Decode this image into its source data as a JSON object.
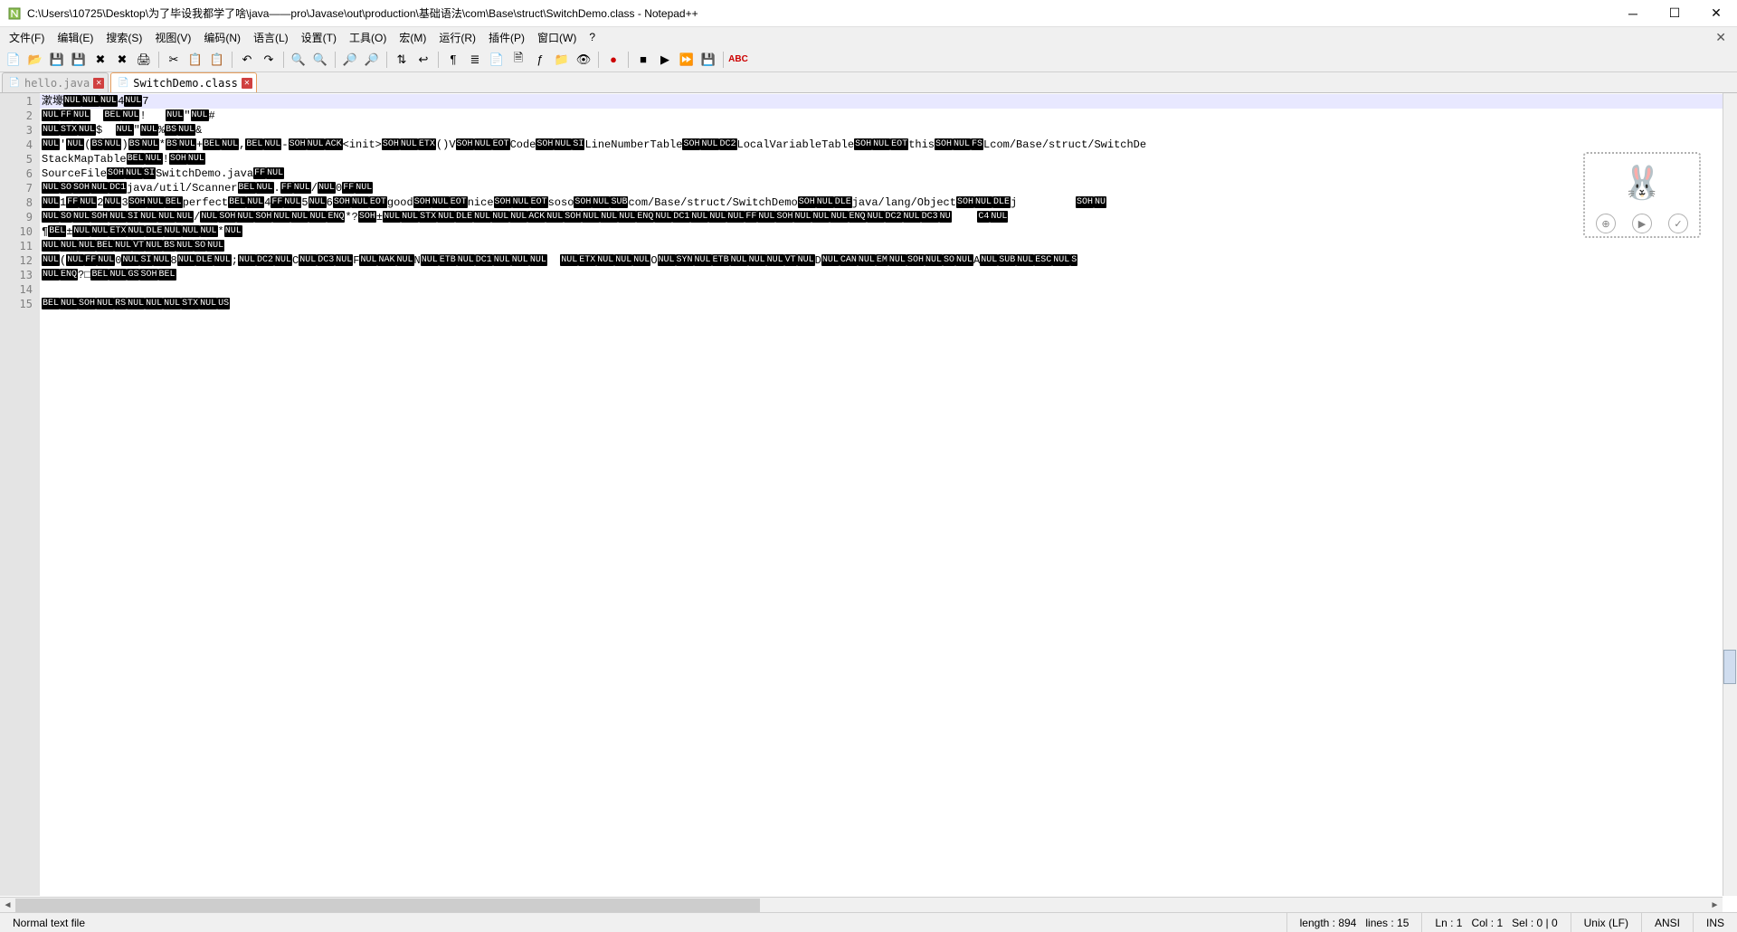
{
  "title": "C:\\Users\\10725\\Desktop\\为了毕设我都学了啥\\java——pro\\Javase\\out\\production\\基础语法\\com\\Base\\struct\\SwitchDemo.class - Notepad++",
  "menus": [
    "文件(F)",
    "编辑(E)",
    "搜索(S)",
    "视图(V)",
    "编码(N)",
    "语言(L)",
    "设置(T)",
    "工具(O)",
    "宏(M)",
    "运行(R)",
    "插件(P)",
    "窗口(W)",
    "?"
  ],
  "tabs": [
    {
      "label": "hello.java",
      "active": false
    },
    {
      "label": "SwitchDemo.class",
      "active": true
    }
  ],
  "status": {
    "filetype": "Normal text file",
    "length": "length : 894",
    "lines": "lines : 15",
    "ln": "Ln : 1",
    "col": "Col : 1",
    "sel": "Sel : 0 | 0",
    "eol": "Unix (LF)",
    "enc": "ANSI",
    "mode": "INS"
  },
  "lines": [
    [
      {
        "t": "txt",
        "v": "漱壕"
      },
      {
        "t": "ctl",
        "v": "NUL"
      },
      {
        "t": "ctl",
        "v": "NUL"
      },
      {
        "t": "ctl",
        "v": "NUL"
      },
      {
        "t": "txt",
        "v": "4"
      },
      {
        "t": "ctl",
        "v": "NUL"
      },
      {
        "t": "txt",
        "v": "7"
      }
    ],
    [
      {
        "t": "ctl",
        "v": "NUL"
      },
      {
        "t": "ctl",
        "v": "FF"
      },
      {
        "t": "ctl",
        "v": "NUL"
      },
      {
        "t": "txt",
        "v": "  "
      },
      {
        "t": "ctl",
        "v": "BEL"
      },
      {
        "t": "ctl",
        "v": "NUL"
      },
      {
        "t": "txt",
        "v": "!   "
      },
      {
        "t": "ctl",
        "v": "NUL"
      },
      {
        "t": "txt",
        "v": "\""
      },
      {
        "t": "ctl",
        "v": "NUL"
      },
      {
        "t": "txt",
        "v": "#"
      }
    ],
    [
      {
        "t": "ctl",
        "v": "NUL"
      },
      {
        "t": "ctl",
        "v": "STX"
      },
      {
        "t": "ctl",
        "v": "NUL"
      },
      {
        "t": "txt",
        "v": "$  "
      },
      {
        "t": "ctl",
        "v": "NUL"
      },
      {
        "t": "txt",
        "v": "\""
      },
      {
        "t": "ctl",
        "v": "NUL"
      },
      {
        "t": "txt",
        "v": "%"
      },
      {
        "t": "ctl",
        "v": "BS"
      },
      {
        "t": "ctl",
        "v": "NUL"
      },
      {
        "t": "txt",
        "v": "&"
      }
    ],
    [
      {
        "t": "ctl",
        "v": "NUL"
      },
      {
        "t": "txt",
        "v": "'"
      },
      {
        "t": "ctl",
        "v": "NUL"
      },
      {
        "t": "txt",
        "v": "("
      },
      {
        "t": "ctl",
        "v": "BS"
      },
      {
        "t": "ctl",
        "v": "NUL"
      },
      {
        "t": "txt",
        "v": ")"
      },
      {
        "t": "ctl",
        "v": "BS"
      },
      {
        "t": "ctl",
        "v": "NUL"
      },
      {
        "t": "txt",
        "v": "*"
      },
      {
        "t": "ctl",
        "v": "BS"
      },
      {
        "t": "ctl",
        "v": "NUL"
      },
      {
        "t": "txt",
        "v": "+"
      },
      {
        "t": "ctl",
        "v": "BEL"
      },
      {
        "t": "ctl",
        "v": "NUL"
      },
      {
        "t": "txt",
        "v": ","
      },
      {
        "t": "ctl",
        "v": "BEL"
      },
      {
        "t": "ctl",
        "v": "NUL"
      },
      {
        "t": "txt",
        "v": "-"
      },
      {
        "t": "ctl",
        "v": "SOH"
      },
      {
        "t": "ctl",
        "v": "NUL"
      },
      {
        "t": "ctl",
        "v": "ACK"
      },
      {
        "t": "txt",
        "v": "<init>"
      },
      {
        "t": "ctl",
        "v": "SOH"
      },
      {
        "t": "ctl",
        "v": "NUL"
      },
      {
        "t": "ctl",
        "v": "ETX"
      },
      {
        "t": "txt",
        "v": "()V"
      },
      {
        "t": "ctl",
        "v": "SOH"
      },
      {
        "t": "ctl",
        "v": "NUL"
      },
      {
        "t": "ctl",
        "v": "EOT"
      },
      {
        "t": "txt",
        "v": "Code"
      },
      {
        "t": "ctl",
        "v": "SOH"
      },
      {
        "t": "ctl",
        "v": "NUL"
      },
      {
        "t": "ctl",
        "v": "SI"
      },
      {
        "t": "txt",
        "v": "LineNumberTable"
      },
      {
        "t": "ctl",
        "v": "SOH"
      },
      {
        "t": "ctl",
        "v": "NUL"
      },
      {
        "t": "ctl",
        "v": "DC2"
      },
      {
        "t": "txt",
        "v": "LocalVariableTable"
      },
      {
        "t": "ctl",
        "v": "SOH"
      },
      {
        "t": "ctl",
        "v": "NUL"
      },
      {
        "t": "ctl",
        "v": "EOT"
      },
      {
        "t": "txt",
        "v": "this"
      },
      {
        "t": "ctl",
        "v": "SOH"
      },
      {
        "t": "ctl",
        "v": "NUL"
      },
      {
        "t": "ctl",
        "v": "FS"
      },
      {
        "t": "txt",
        "v": "Lcom/Base/struct/SwitchDe"
      }
    ],
    [
      {
        "t": "txt",
        "v": "StackMapTable"
      },
      {
        "t": "ctl",
        "v": "BEL"
      },
      {
        "t": "ctl",
        "v": "NUL"
      },
      {
        "t": "txt",
        "v": "!"
      },
      {
        "t": "ctl",
        "v": "SOH"
      },
      {
        "t": "ctl",
        "v": "NUL"
      }
    ],
    [
      {
        "t": "txt",
        "v": "SourceFile"
      },
      {
        "t": "ctl",
        "v": "SOH"
      },
      {
        "t": "ctl",
        "v": "NUL"
      },
      {
        "t": "ctl",
        "v": "SI"
      },
      {
        "t": "txt",
        "v": "SwitchDemo.java"
      },
      {
        "t": "ctl",
        "v": "FF"
      },
      {
        "t": "ctl",
        "v": "NUL"
      }
    ],
    [
      {
        "t": "ctl",
        "v": "NUL"
      },
      {
        "t": "ctl",
        "v": "SO"
      },
      {
        "t": "ctl",
        "v": "SOH"
      },
      {
        "t": "ctl",
        "v": "NUL"
      },
      {
        "t": "ctl",
        "v": "DC1"
      },
      {
        "t": "txt",
        "v": "java/util/Scanner"
      },
      {
        "t": "ctl",
        "v": "BEL"
      },
      {
        "t": "ctl",
        "v": "NUL"
      },
      {
        "t": "txt",
        "v": "."
      },
      {
        "t": "ctl",
        "v": "FF"
      },
      {
        "t": "ctl",
        "v": "NUL"
      },
      {
        "t": "txt",
        "v": "/"
      },
      {
        "t": "ctl",
        "v": "NUL"
      },
      {
        "t": "txt",
        "v": "0"
      },
      {
        "t": "ctl",
        "v": "FF"
      },
      {
        "t": "ctl",
        "v": "NUL"
      }
    ],
    [
      {
        "t": "ctl",
        "v": "NUL"
      },
      {
        "t": "txt",
        "v": "1"
      },
      {
        "t": "ctl",
        "v": "FF"
      },
      {
        "t": "ctl",
        "v": "NUL"
      },
      {
        "t": "txt",
        "v": "2"
      },
      {
        "t": "ctl",
        "v": "NUL"
      },
      {
        "t": "txt",
        "v": "3"
      },
      {
        "t": "ctl",
        "v": "SOH"
      },
      {
        "t": "ctl",
        "v": "NUL"
      },
      {
        "t": "ctl",
        "v": "BEL"
      },
      {
        "t": "txt",
        "v": "perfect"
      },
      {
        "t": "ctl",
        "v": "BEL"
      },
      {
        "t": "ctl",
        "v": "NUL"
      },
      {
        "t": "txt",
        "v": "4"
      },
      {
        "t": "ctl",
        "v": "FF"
      },
      {
        "t": "ctl",
        "v": "NUL"
      },
      {
        "t": "txt",
        "v": "5"
      },
      {
        "t": "ctl",
        "v": "NUL"
      },
      {
        "t": "txt",
        "v": "6"
      },
      {
        "t": "ctl",
        "v": "SOH"
      },
      {
        "t": "ctl",
        "v": "NUL"
      },
      {
        "t": "ctl",
        "v": "EOT"
      },
      {
        "t": "txt",
        "v": "good"
      },
      {
        "t": "ctl",
        "v": "SOH"
      },
      {
        "t": "ctl",
        "v": "NUL"
      },
      {
        "t": "ctl",
        "v": "EOT"
      },
      {
        "t": "txt",
        "v": "nice"
      },
      {
        "t": "ctl",
        "v": "SOH"
      },
      {
        "t": "ctl",
        "v": "NUL"
      },
      {
        "t": "ctl",
        "v": "EOT"
      },
      {
        "t": "txt",
        "v": "soso"
      },
      {
        "t": "ctl",
        "v": "SOH"
      },
      {
        "t": "ctl",
        "v": "NUL"
      },
      {
        "t": "ctl",
        "v": "SUB"
      },
      {
        "t": "txt",
        "v": "com/Base/struct/SwitchDemo"
      },
      {
        "t": "ctl",
        "v": "SOH"
      },
      {
        "t": "ctl",
        "v": "NUL"
      },
      {
        "t": "ctl",
        "v": "DLE"
      },
      {
        "t": "txt",
        "v": "java/lang/Object"
      },
      {
        "t": "ctl",
        "v": "SOH"
      },
      {
        "t": "ctl",
        "v": "NUL"
      },
      {
        "t": "ctl",
        "v": "DLE"
      },
      {
        "t": "txt",
        "v": "j         "
      },
      {
        "t": "ctl",
        "v": "SOH"
      },
      {
        "t": "ctl",
        "v": "NU"
      }
    ],
    [
      {
        "t": "ctl",
        "v": "NUL"
      },
      {
        "t": "ctl",
        "v": "SO"
      },
      {
        "t": "ctl",
        "v": "NUL"
      },
      {
        "t": "ctl",
        "v": "SOH"
      },
      {
        "t": "ctl",
        "v": "NUL"
      },
      {
        "t": "ctl",
        "v": "SI"
      },
      {
        "t": "ctl",
        "v": "NUL"
      },
      {
        "t": "ctl",
        "v": "NUL"
      },
      {
        "t": "ctl",
        "v": "NUL"
      },
      {
        "t": "txt",
        "v": "/"
      },
      {
        "t": "ctl",
        "v": "NUL"
      },
      {
        "t": "ctl",
        "v": "SOH"
      },
      {
        "t": "ctl",
        "v": "NUL"
      },
      {
        "t": "ctl",
        "v": "SOH"
      },
      {
        "t": "ctl",
        "v": "NUL"
      },
      {
        "t": "ctl",
        "v": "NUL"
      },
      {
        "t": "ctl",
        "v": "NUL"
      },
      {
        "t": "ctl",
        "v": "ENQ"
      },
      {
        "t": "txt",
        "v": "*?"
      },
      {
        "t": "ctl",
        "v": "SOH"
      },
      {
        "t": "txt",
        "v": "±"
      },
      {
        "t": "ctl",
        "v": "NUL"
      },
      {
        "t": "ctl",
        "v": "NUL"
      },
      {
        "t": "ctl",
        "v": "STX"
      },
      {
        "t": "ctl",
        "v": "NUL"
      },
      {
        "t": "ctl",
        "v": "DLE"
      },
      {
        "t": "ctl",
        "v": "NUL"
      },
      {
        "t": "ctl",
        "v": "NUL"
      },
      {
        "t": "ctl",
        "v": "NUL"
      },
      {
        "t": "ctl",
        "v": "ACK"
      },
      {
        "t": "ctl",
        "v": "NUL"
      },
      {
        "t": "ctl",
        "v": "SOH"
      },
      {
        "t": "ctl",
        "v": "NUL"
      },
      {
        "t": "ctl",
        "v": "NUL"
      },
      {
        "t": "ctl",
        "v": "NUL"
      },
      {
        "t": "ctl",
        "v": "ENQ"
      },
      {
        "t": "ctl",
        "v": "NUL"
      },
      {
        "t": "ctl",
        "v": "DC1"
      },
      {
        "t": "ctl",
        "v": "NUL"
      },
      {
        "t": "ctl",
        "v": "NUL"
      },
      {
        "t": "ctl",
        "v": "NUL"
      },
      {
        "t": "ctl",
        "v": "FF"
      },
      {
        "t": "ctl",
        "v": "NUL"
      },
      {
        "t": "ctl",
        "v": "SOH"
      },
      {
        "t": "ctl",
        "v": "NUL"
      },
      {
        "t": "ctl",
        "v": "NUL"
      },
      {
        "t": "ctl",
        "v": "NUL"
      },
      {
        "t": "ctl",
        "v": "ENQ"
      },
      {
        "t": "ctl",
        "v": "NUL"
      },
      {
        "t": "ctl",
        "v": "DC2"
      },
      {
        "t": "ctl",
        "v": "NUL"
      },
      {
        "t": "ctl",
        "v": "DC3"
      },
      {
        "t": "ctl",
        "v": "NU"
      },
      {
        "t": "txt",
        "v": "    "
      },
      {
        "t": "ctl",
        "v": "C4"
      },
      {
        "t": "ctl",
        "v": "NUL"
      }
    ],
    [
      {
        "t": "txt",
        "v": "¶"
      },
      {
        "t": "ctl",
        "v": "BEL"
      },
      {
        "t": "txt",
        "v": "±"
      },
      {
        "t": "ctl",
        "v": "NUL"
      },
      {
        "t": "ctl",
        "v": "NUL"
      },
      {
        "t": "ctl",
        "v": "ETX"
      },
      {
        "t": "ctl",
        "v": "NUL"
      },
      {
        "t": "ctl",
        "v": "DLE"
      },
      {
        "t": "ctl",
        "v": "NUL"
      },
      {
        "t": "ctl",
        "v": "NUL"
      },
      {
        "t": "ctl",
        "v": "NUL"
      },
      {
        "t": "txt",
        "v": "*"
      },
      {
        "t": "ctl",
        "v": "NUL"
      }
    ],
    [
      {
        "t": "ctl",
        "v": "NUL"
      },
      {
        "t": "ctl",
        "v": "NUL"
      },
      {
        "t": "ctl",
        "v": "NUL"
      },
      {
        "t": "ctl",
        "v": "BEL"
      },
      {
        "t": "ctl",
        "v": "NUL"
      },
      {
        "t": "ctl",
        "v": "VT"
      },
      {
        "t": "ctl",
        "v": "NUL"
      },
      {
        "t": "ctl",
        "v": "BS"
      },
      {
        "t": "ctl",
        "v": "NUL"
      },
      {
        "t": "ctl",
        "v": "SO"
      },
      {
        "t": "ctl",
        "v": "NUL"
      }
    ],
    [
      {
        "t": "ctl",
        "v": "NUL"
      },
      {
        "t": "txt",
        "v": "("
      },
      {
        "t": "ctl",
        "v": "NUL"
      },
      {
        "t": "ctl",
        "v": "FF"
      },
      {
        "t": "ctl",
        "v": "NUL"
      },
      {
        "t": "txt",
        "v": "0"
      },
      {
        "t": "ctl",
        "v": "NUL"
      },
      {
        "t": "ctl",
        "v": "SI"
      },
      {
        "t": "ctl",
        "v": "NUL"
      },
      {
        "t": "txt",
        "v": "8"
      },
      {
        "t": "ctl",
        "v": "NUL"
      },
      {
        "t": "ctl",
        "v": "DLE"
      },
      {
        "t": "ctl",
        "v": "NUL"
      },
      {
        "t": "txt",
        "v": ";"
      },
      {
        "t": "ctl",
        "v": "NUL"
      },
      {
        "t": "ctl",
        "v": "DC2"
      },
      {
        "t": "ctl",
        "v": "NUL"
      },
      {
        "t": "txt",
        "v": "C"
      },
      {
        "t": "ctl",
        "v": "NUL"
      },
      {
        "t": "ctl",
        "v": "DC3"
      },
      {
        "t": "ctl",
        "v": "NUL"
      },
      {
        "t": "txt",
        "v": "F"
      },
      {
        "t": "ctl",
        "v": "NUL"
      },
      {
        "t": "ctl",
        "v": "NAK"
      },
      {
        "t": "ctl",
        "v": "NUL"
      },
      {
        "t": "txt",
        "v": "N"
      },
      {
        "t": "ctl",
        "v": "NUL"
      },
      {
        "t": "ctl",
        "v": "ETB"
      },
      {
        "t": "ctl",
        "v": "NUL"
      },
      {
        "t": "ctl",
        "v": "DC1"
      },
      {
        "t": "ctl",
        "v": "NUL"
      },
      {
        "t": "ctl",
        "v": "NUL"
      },
      {
        "t": "ctl",
        "v": "NUL"
      },
      {
        "t": "txt",
        "v": "  "
      },
      {
        "t": "ctl",
        "v": "NUL"
      },
      {
        "t": "ctl",
        "v": "ETX"
      },
      {
        "t": "ctl",
        "v": "NUL"
      },
      {
        "t": "ctl",
        "v": "NUL"
      },
      {
        "t": "ctl",
        "v": "NUL"
      },
      {
        "t": "txt",
        "v": "O"
      },
      {
        "t": "ctl",
        "v": "NUL"
      },
      {
        "t": "ctl",
        "v": "SYN"
      },
      {
        "t": "ctl",
        "v": "NUL"
      },
      {
        "t": "ctl",
        "v": "ETB"
      },
      {
        "t": "ctl",
        "v": "NUL"
      },
      {
        "t": "ctl",
        "v": "NUL"
      },
      {
        "t": "ctl",
        "v": "NUL"
      },
      {
        "t": "ctl",
        "v": "VT"
      },
      {
        "t": "ctl",
        "v": "NUL"
      },
      {
        "t": "txt",
        "v": "D"
      },
      {
        "t": "ctl",
        "v": "NUL"
      },
      {
        "t": "ctl",
        "v": "CAN"
      },
      {
        "t": "ctl",
        "v": "NUL"
      },
      {
        "t": "ctl",
        "v": "EM"
      },
      {
        "t": "ctl",
        "v": "NUL"
      },
      {
        "t": "ctl",
        "v": "SOH"
      },
      {
        "t": "ctl",
        "v": "NUL"
      },
      {
        "t": "ctl",
        "v": "SO"
      },
      {
        "t": "ctl",
        "v": "NUL"
      },
      {
        "t": "txt",
        "v": "A"
      },
      {
        "t": "ctl",
        "v": "NUL"
      },
      {
        "t": "ctl",
        "v": "SUB"
      },
      {
        "t": "ctl",
        "v": "NUL"
      },
      {
        "t": "ctl",
        "v": "ESC"
      },
      {
        "t": "ctl",
        "v": "NUL"
      },
      {
        "t": "ctl",
        "v": "S"
      }
    ],
    [
      {
        "t": "ctl",
        "v": "NUL"
      },
      {
        "t": "ctl",
        "v": "ENQ"
      },
      {
        "t": "txt",
        "v": "?□"
      },
      {
        "t": "ctl",
        "v": "BEL"
      },
      {
        "t": "ctl",
        "v": "NUL"
      },
      {
        "t": "ctl",
        "v": "GS"
      },
      {
        "t": "ctl",
        "v": "SOH"
      },
      {
        "t": "ctl",
        "v": "BEL"
      }
    ],
    [],
    [
      {
        "t": "ctl",
        "v": "BEL"
      },
      {
        "t": "ctl",
        "v": "NUL"
      },
      {
        "t": "ctl",
        "v": "SOH"
      },
      {
        "t": "ctl",
        "v": "NUL"
      },
      {
        "t": "ctl",
        "v": "RS"
      },
      {
        "t": "ctl",
        "v": "NUL"
      },
      {
        "t": "ctl",
        "v": "NUL"
      },
      {
        "t": "ctl",
        "v": "NUL"
      },
      {
        "t": "ctl",
        "v": "STX"
      },
      {
        "t": "ctl",
        "v": "NUL"
      },
      {
        "t": "ctl",
        "v": "US"
      }
    ]
  ]
}
